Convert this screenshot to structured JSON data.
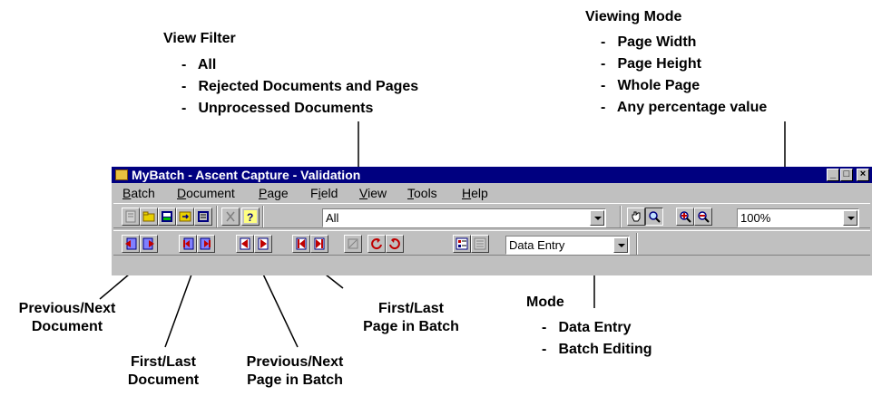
{
  "annotations": {
    "view_filter": {
      "title": "View Filter",
      "options": [
        "All",
        "Rejected Documents and Pages",
        "Unprocessed Documents"
      ]
    },
    "viewing_mode": {
      "title": "Viewing Mode",
      "options": [
        "Page Width",
        "Page Height",
        "Whole Page",
        "Any percentage value"
      ]
    },
    "mode": {
      "title": "Mode",
      "options": [
        "Data Entry",
        "Batch Editing"
      ]
    },
    "prev_next_document": [
      "Previous/Next",
      "Document"
    ],
    "first_last_document": [
      "First/Last",
      "Document"
    ],
    "prev_next_page": [
      "Previous/Next",
      "Page in Batch"
    ],
    "first_last_page": [
      "First/Last",
      "Page in Batch"
    ]
  },
  "window": {
    "title": "MyBatch - Ascent Capture - Validation",
    "menu": [
      {
        "u": "B",
        "rest": "atch"
      },
      {
        "u": "D",
        "rest": "ocument"
      },
      {
        "u": "P",
        "rest": "age"
      },
      {
        "pre": "F",
        "u": "i",
        "rest": "eld"
      },
      {
        "u": "V",
        "rest": "iew"
      },
      {
        "u": "T",
        "rest": "ools"
      },
      {
        "u": "H",
        "rest": "elp"
      }
    ],
    "view_filter_value": "All",
    "zoom_value": "100%",
    "mode_value": "Data Entry"
  },
  "icons": [
    "document-icon",
    "open-folder-icon",
    "batch-icon",
    "export-icon",
    "properties-icon",
    "scissors-icon",
    "help-icon",
    "hand-pan-icon",
    "zoom-icon",
    "zoom-in-icon",
    "zoom-out-icon",
    "prev-document-icon",
    "next-document-icon",
    "first-document-icon",
    "last-document-icon",
    "prev-page-icon",
    "next-page-icon",
    "first-page-icon",
    "last-page-icon",
    "edit-disabled-icon",
    "rotate-left-icon",
    "rotate-right-icon",
    "field-list-icon",
    "field-properties-icon"
  ],
  "colors": {
    "titlebar": "#000080",
    "face": "#c0c0c0",
    "red": "#c00000"
  }
}
